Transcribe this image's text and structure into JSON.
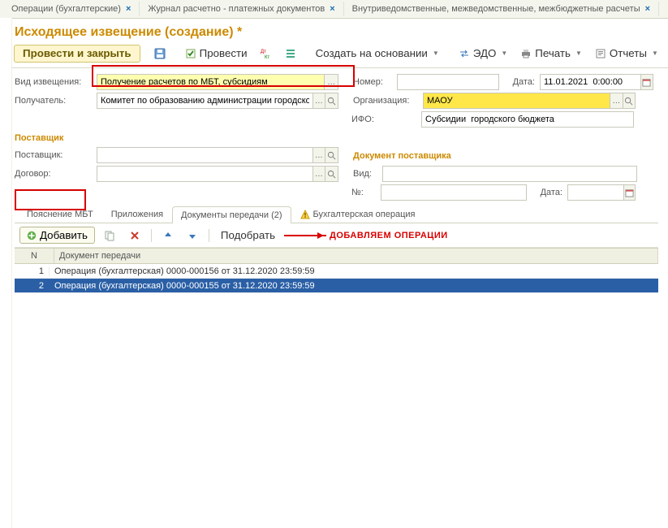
{
  "app_tabs": [
    {
      "label": "Операции (бухгалтерские)"
    },
    {
      "label": "Журнал расчетно - платежных документов"
    },
    {
      "label": "Внутриведомственные, межведомственные, межбюджетные расчеты"
    }
  ],
  "page_title": "Исходящее извещение (создание) *",
  "toolbar": {
    "post_close": "Провести и закрыть",
    "post": "Провести",
    "create_base": "Создать на основании",
    "edo": "ЭДО",
    "print": "Печать",
    "reports": "Отчеты"
  },
  "form": {
    "vid_label": "Вид извещения:",
    "vid_value": "Получение расчетов по МБТ, субсидиям",
    "nomer_label": "Номер:",
    "nomer_value": "",
    "date_label": "Дата:",
    "date_value": "11.01.2021  0:00:00",
    "recipient_label": "Получатель:",
    "recipient_value": "Комитет по образованию администрации городского окр …",
    "org_label": "Организация:",
    "org_value": "МАОУ",
    "ifo_label": "ИФО:",
    "ifo_value": "Субсидии  городского бюджета",
    "supplier_section": "Поставщик",
    "supplier_label": "Поставщик:",
    "supplier_value": "",
    "supplier_doc_section": "Документ поставщика",
    "contract_label": "Договор:",
    "contract_value": "",
    "vid2_label": "Вид:",
    "vid2_value": "",
    "no_label": "№:",
    "no_value": "",
    "date2_label": "Дата:",
    "date2_value": ""
  },
  "inner_tabs": {
    "t1": "Пояснение МБТ",
    "t2": "Приложения",
    "t3": "Документы передачи (2)",
    "t4": "Бухгалтерская операция"
  },
  "subtoolbar": {
    "add": "Добавить",
    "pick": "Подобрать"
  },
  "annotation": "ДОБАВЛЯЕМ ОПЕРАЦИИ",
  "table": {
    "col_n": "N",
    "col_doc": "Документ передачи",
    "rows": [
      {
        "n": "1",
        "doc": "Операция (бухгалтерская) 0000-000156 от 31.12.2020 23:59:59",
        "selected": false
      },
      {
        "n": "2",
        "doc": "Операция (бухгалтерская) 0000-000155 от 31.12.2020 23:59:59",
        "selected": true
      }
    ]
  }
}
